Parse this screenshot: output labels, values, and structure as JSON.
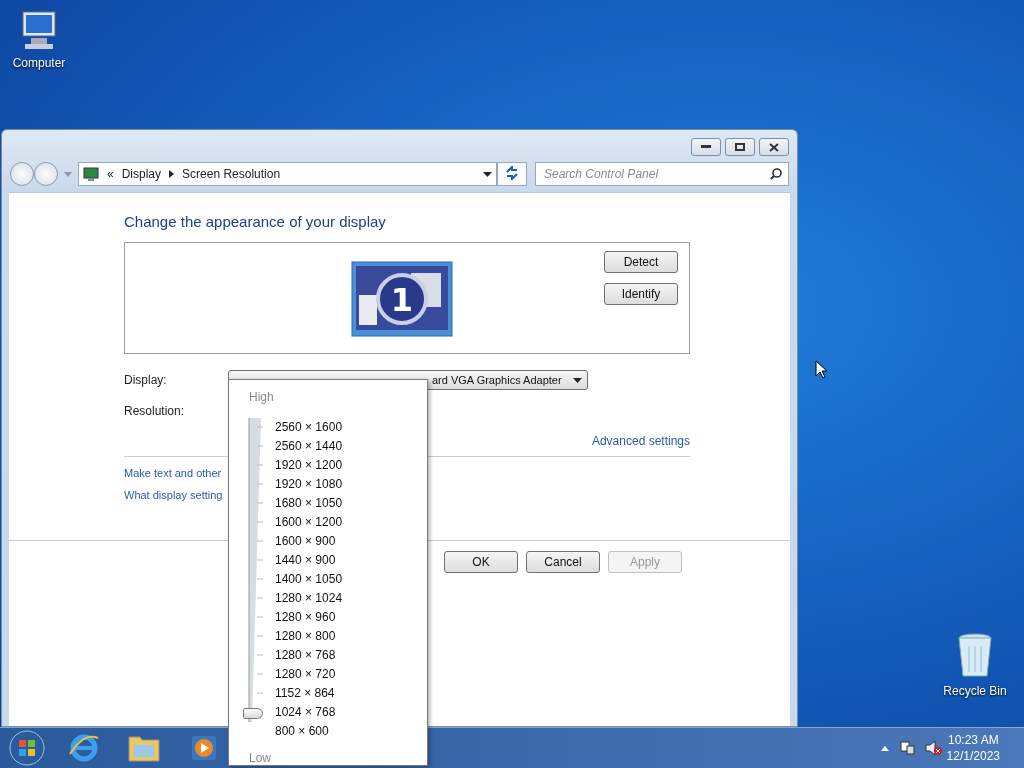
{
  "desktop_icons": [
    {
      "label": "Computer",
      "kind": "computer"
    },
    {
      "label": "Recycle Bin",
      "kind": "bin"
    }
  ],
  "window": {
    "breadcrumb": [
      "«",
      "Display",
      "Screen Resolution"
    ],
    "search": {
      "placeholder": "Search Control Panel"
    }
  },
  "content": {
    "heading": "Change the appearance of your display",
    "monitor_number": "1",
    "buttons": [
      "Detect",
      "Identify"
    ],
    "display": {
      "label": "Display:",
      "value": "ard VGA Graphics Adapter"
    },
    "resolution": {
      "label": "Resolution:"
    },
    "advanced_link": "Advanced settings",
    "links": [
      "Make text and other",
      "What display setting"
    ],
    "dialog_buttons": [
      {
        "label": "OK",
        "disabled": false
      },
      {
        "label": "Cancel",
        "disabled": false
      },
      {
        "label": "Apply",
        "disabled": true
      }
    ]
  },
  "resolution_popup": {
    "high": "High",
    "low": "Low",
    "level": 0.0625,
    "options": [
      "2560 × 1600",
      "2560 × 1440",
      "1920 × 1200",
      "1920 × 1080",
      "1680 × 1050",
      "1600 × 1200",
      "1600 × 900",
      "1440 × 900",
      "1400 × 1050",
      "1280 × 1024",
      "1280 × 960",
      "1280 × 800",
      "1280 × 768",
      "1280 × 720",
      "1152 × 864",
      "1024 × 768",
      "800 × 600"
    ]
  },
  "taskbar": {
    "clock": {
      "time": "10:23 AM",
      "date": "12/1/2023"
    }
  }
}
